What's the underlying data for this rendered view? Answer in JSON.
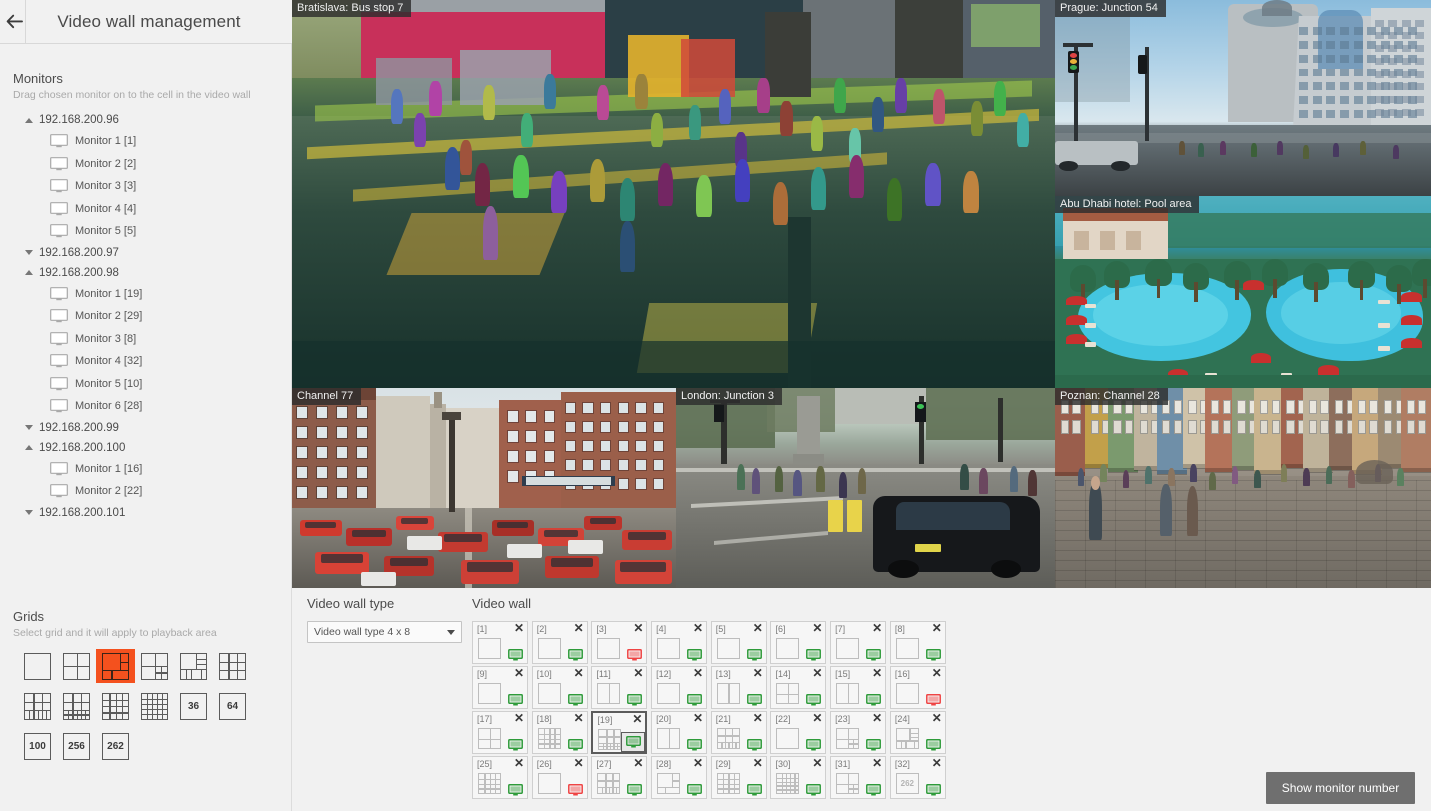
{
  "header": {
    "title": "Video wall management",
    "back_icon": "arrow-left-icon"
  },
  "sidebar": {
    "monitors": {
      "title": "Monitors",
      "subtitle": "Drag chosen monitor on to the cell in the video wall",
      "servers": [
        {
          "label": "192.168.200.96",
          "expanded": true,
          "monitors": [
            "Monitor 1 [1]",
            "Monitor 2 [2]",
            "Monitor 3 [3]",
            "Monitor 4 [4]",
            "Monitor 5 [5]"
          ]
        },
        {
          "label": "192.168.200.97",
          "expanded": false,
          "monitors": []
        },
        {
          "label": "192.168.200.98",
          "expanded": true,
          "monitors": [
            "Monitor 1 [19]",
            "Monitor 2 [29]",
            "Monitor 3 [8]",
            "Monitor 4 [32]",
            "Monitor 5 [10]",
            "Monitor 6 [28]"
          ]
        },
        {
          "label": "192.168.200.99",
          "expanded": false,
          "monitors": []
        },
        {
          "label": "192.168.200.100",
          "expanded": true,
          "monitors": [
            "Monitor 1 [16]",
            "Monitor 2 [22]"
          ]
        },
        {
          "label": "192.168.200.101",
          "expanded": false,
          "monitors": []
        }
      ]
    },
    "grids": {
      "title": "Grids",
      "subtitle": "Select grid and it will apply to playback area",
      "selected_index": 2,
      "accent_color": "#f4511e",
      "items": [
        {
          "name": "grid-1x1",
          "kind": "layout",
          "layout": "1x1"
        },
        {
          "name": "grid-2x2",
          "kind": "layout",
          "layout": "2x2"
        },
        {
          "name": "grid-2x2-plus",
          "kind": "layout",
          "layout": "2x2-plus"
        },
        {
          "name": "grid-2x2-quad",
          "kind": "layout",
          "layout": "2x2-quad"
        },
        {
          "name": "grid-1-plus-strip",
          "kind": "layout",
          "layout": "1-plus-strip"
        },
        {
          "name": "grid-3x3",
          "kind": "layout",
          "layout": "3x3"
        },
        {
          "name": "grid-3x3-strip",
          "kind": "layout",
          "layout": "3x3-strip"
        },
        {
          "name": "grid-3x3-mixed",
          "kind": "layout",
          "layout": "3x3-mixed"
        },
        {
          "name": "grid-4x4",
          "kind": "layout",
          "layout": "4x4"
        },
        {
          "name": "grid-5x5",
          "kind": "layout",
          "layout": "5x5"
        },
        {
          "name": "grid-36",
          "kind": "number",
          "label": "36"
        },
        {
          "name": "grid-64",
          "kind": "number",
          "label": "64"
        },
        {
          "name": "grid-100",
          "kind": "number",
          "label": "100"
        },
        {
          "name": "grid-256",
          "kind": "number",
          "label": "256"
        },
        {
          "name": "grid-262",
          "kind": "number",
          "label": "262"
        }
      ]
    }
  },
  "video_panels": [
    {
      "label": "Bratislava: Bus stop 7",
      "scene": "bus-stop"
    },
    {
      "label": "Prague: Junction 54",
      "scene": "prague"
    },
    {
      "label": "Abu Dhabi hotel: Pool area",
      "scene": "pool"
    },
    {
      "label": "Channel 77",
      "scene": "street"
    },
    {
      "label": "London: Junction 3",
      "scene": "london"
    },
    {
      "label": "Poznan: Channel 28",
      "scene": "poznan"
    }
  ],
  "bottom": {
    "wall_type": {
      "title": "Video wall type",
      "selected": "Video wall type 4 x 8"
    },
    "wall": {
      "title": "Video wall",
      "selected_cell": "[19]",
      "cells": [
        {
          "id": "[19]",
          "n": 1,
          "label": "[1]",
          "layout": "1x1",
          "status": "green"
        },
        {
          "id": "[2]",
          "n": 2,
          "label": "[2]",
          "layout": "1x1",
          "status": "green"
        },
        {
          "id": "[3]",
          "n": 3,
          "label": "[3]",
          "layout": "1x1",
          "status": "red"
        },
        {
          "id": "[4]",
          "n": 4,
          "label": "[4]",
          "layout": "1x1",
          "status": "green"
        },
        {
          "id": "[5]",
          "n": 5,
          "label": "[5]",
          "layout": "1x1",
          "status": "green"
        },
        {
          "id": "[6]",
          "n": 6,
          "label": "[6]",
          "layout": "1x1",
          "status": "green"
        },
        {
          "id": "[7]",
          "n": 7,
          "label": "[7]",
          "layout": "1x1",
          "status": "green"
        },
        {
          "id": "[8]",
          "n": 8,
          "label": "[8]",
          "layout": "1x1",
          "status": "green"
        },
        {
          "id": "[9]",
          "n": 9,
          "label": "[9]",
          "layout": "1x1",
          "status": "green"
        },
        {
          "id": "[10]",
          "n": 10,
          "label": "[10]",
          "layout": "1x1",
          "status": "green"
        },
        {
          "id": "[11]",
          "n": 11,
          "label": "[11]",
          "layout": "1x2",
          "status": "green"
        },
        {
          "id": "[12]",
          "n": 12,
          "label": "[12]",
          "layout": "1x1",
          "status": "green"
        },
        {
          "id": "[13]",
          "n": 13,
          "label": "[13]",
          "layout": "1x2",
          "status": "green"
        },
        {
          "id": "[14]",
          "n": 14,
          "label": "[14]",
          "layout": "2x2",
          "status": "green"
        },
        {
          "id": "[15]",
          "n": 15,
          "label": "[15]",
          "layout": "1x2",
          "status": "green"
        },
        {
          "id": "[16]",
          "n": 16,
          "label": "[16]",
          "layout": "1x1",
          "status": "red"
        },
        {
          "id": "[17]",
          "n": 17,
          "label": "[17]",
          "layout": "2x2",
          "status": "green"
        },
        {
          "id": "[18]",
          "n": 18,
          "label": "[18]",
          "layout": "4x4",
          "status": "green"
        },
        {
          "id": "[19]",
          "n": 19,
          "label": "[19]",
          "layout": "3x3-mixed",
          "status": "green",
          "selected": true
        },
        {
          "id": "[20]",
          "n": 20,
          "label": "[20]",
          "layout": "1x2",
          "status": "green"
        },
        {
          "id": "[21]",
          "n": 21,
          "label": "[21]",
          "layout": "3x3-strip",
          "status": "green"
        },
        {
          "id": "[22]",
          "n": 22,
          "label": "[22]",
          "layout": "1x1",
          "status": "green"
        },
        {
          "id": "[23]",
          "n": 23,
          "label": "[23]",
          "layout": "2x2-quad",
          "status": "green"
        },
        {
          "id": "[24]",
          "n": 24,
          "label": "[24]",
          "layout": "1-plus-strip",
          "status": "green"
        },
        {
          "id": "[25]",
          "n": 25,
          "label": "[25]",
          "layout": "4x4",
          "status": "green"
        },
        {
          "id": "[26]",
          "n": 26,
          "label": "[26]",
          "layout": "1x1",
          "status": "red"
        },
        {
          "id": "[27]",
          "n": 27,
          "label": "[27]",
          "layout": "3x3-strip",
          "status": "green"
        },
        {
          "id": "[28]",
          "n": 28,
          "label": "[28]",
          "layout": "2x2-plus",
          "status": "green"
        },
        {
          "id": "[29]",
          "n": 29,
          "label": "[29]",
          "layout": "4x4",
          "status": "green"
        },
        {
          "id": "[30]",
          "n": 30,
          "label": "[30]",
          "layout": "5x5",
          "status": "green"
        },
        {
          "id": "[31]",
          "n": 31,
          "label": "[31]",
          "layout": "2x2-quad",
          "status": "green"
        },
        {
          "id": "[32]",
          "n": 32,
          "label": "[32]",
          "layout": "number",
          "number_label": "262",
          "status": "green"
        }
      ],
      "close_icon": "close-icon",
      "status_colors": {
        "green": "#2e9b3a",
        "red": "#ef4444"
      }
    },
    "show_button": "Show monitor number"
  }
}
